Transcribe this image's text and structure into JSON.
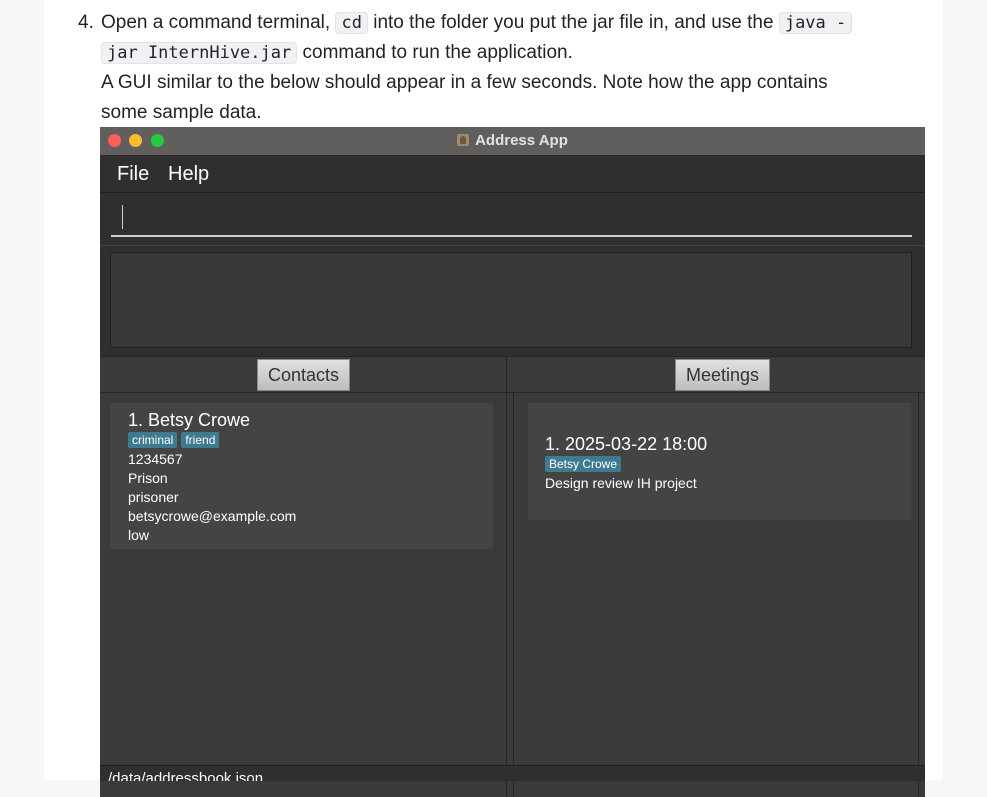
{
  "doc": {
    "step_number": "4.",
    "line1_a": "Open a command terminal,",
    "code_cd": "cd",
    "line1_b": "into the folder you put the jar file in, and use the",
    "code_java_a": "java -",
    "code_java_b": "jar InternHive.jar",
    "line2_b": "command to run the application.",
    "line3": "A GUI similar to the below should appear in a few seconds. Note how the app contains",
    "line4": "some sample data."
  },
  "window": {
    "title": "Address App",
    "menu": [
      "File",
      "Help"
    ],
    "command_value": "",
    "result_text": "",
    "contacts_button": "Contacts",
    "meetings_button": "Meetings",
    "status_path": "/data/addressbook.json"
  },
  "contacts": [
    {
      "name": "1. Betsy Crowe",
      "tags": [
        "criminal",
        "friend"
      ],
      "phone": "1234567",
      "address": "Prison",
      "role": "prisoner",
      "email": "betsycrowe@example.com",
      "priority": "low"
    }
  ],
  "meetings": [
    {
      "title": "1. 2025-03-22 18:00",
      "tags": [
        "Betsy Crowe"
      ],
      "description": "Design review IH project"
    }
  ]
}
